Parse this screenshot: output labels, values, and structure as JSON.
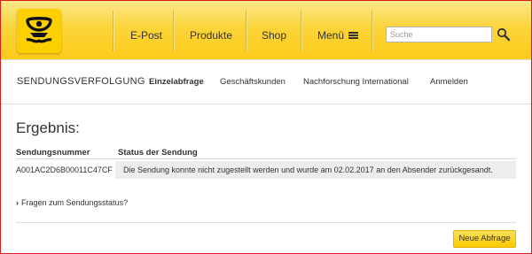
{
  "header": {
    "logo_icon": "deutsche-post-horn-icon",
    "nav": [
      "E-Post",
      "Produkte",
      "Shop",
      "Menü"
    ],
    "menu_icon": "hamburger-icon",
    "search_placeholder": "Suche",
    "search_icon": "magnifier-icon"
  },
  "subnav": {
    "title": "SENDUNGSVERFOLGUNG",
    "items": [
      "Einzelabfrage",
      "Geschäftskunden",
      "Nachforschung International",
      "Anmelden"
    ]
  },
  "result": {
    "title": "Ergebnis:",
    "columns": [
      "Sendungsnummer",
      "Status der Sendung"
    ],
    "rows": [
      {
        "tracking_number": "A001AC2D6B00011C47CF",
        "status": "Die Sendung konnte nicht zugestellt werden und wurde am 02.02.2017 an den Absender zurückgesandt."
      }
    ],
    "faq_link": "Fragen zum Sendungsstatus?",
    "new_query_button": "Neue Abfrage"
  },
  "colors": {
    "brand_yellow": "#fcd000",
    "frame_red": "#d61c1c"
  }
}
